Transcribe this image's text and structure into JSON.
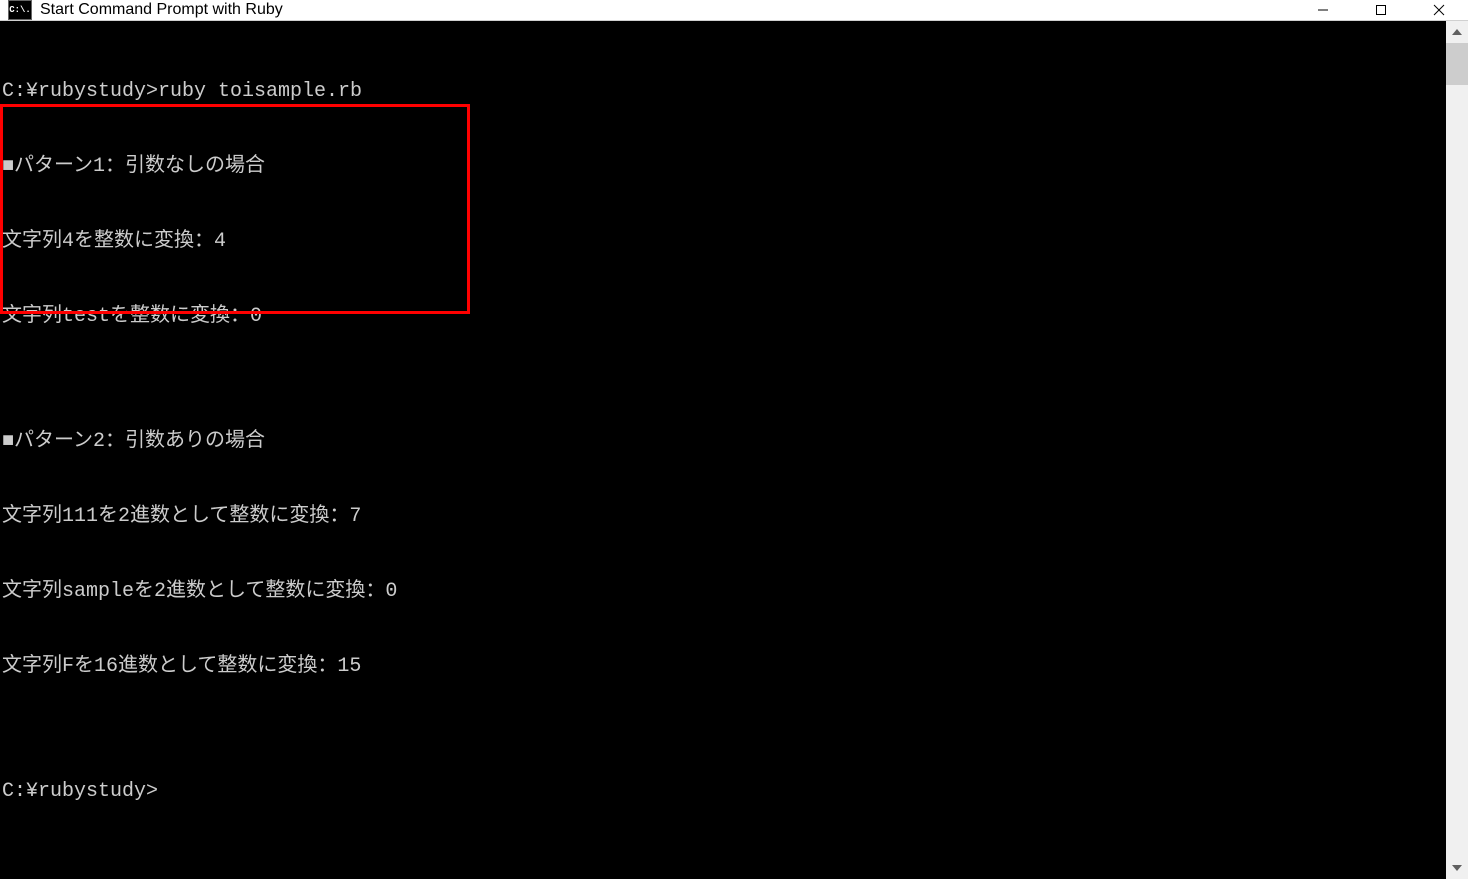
{
  "window": {
    "title": "Start Command Prompt with Ruby",
    "icon_label": "C:\\."
  },
  "terminal": {
    "lines": [
      "C:¥rubystudy>ruby toisample.rb",
      "■パターン1：引数なしの場合",
      "文字列4を整数に変換：4",
      "文字列testを整数に変換：0",
      "",
      "■パターン2：引数ありの場合",
      "文字列111を2進数として整数に変換：7",
      "文字列sampleを2進数として整数に変換：0",
      "文字列Fを16進数として整数に変換：15",
      "",
      "C:¥rubystudy>"
    ]
  }
}
